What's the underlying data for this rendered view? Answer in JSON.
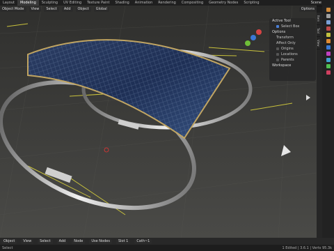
{
  "topbar": {
    "tabs": [
      "Layout",
      "Modeling",
      "Sculpting",
      "UV Editing",
      "Texture Paint",
      "Shading",
      "Animation",
      "Rendering",
      "Compositing",
      "Geometry Nodes",
      "Scripting"
    ],
    "scene": "Scene"
  },
  "viewport_header": {
    "mode": "Object Mode",
    "view": "View",
    "select": "Select",
    "add": "Add",
    "object": "Object",
    "orientation": "Global",
    "options": "Options"
  },
  "npanel": {
    "active_tool": "Active Tool",
    "tool_name": "Select Box",
    "options": "Options",
    "transform": "Transform",
    "affect_only": "Affect Only",
    "origins": "Origins",
    "locations": "Locations",
    "parents": "Parents",
    "workspace": "Workspace"
  },
  "sidetabs": [
    "Item",
    "Tool",
    "View"
  ],
  "bottombar": {
    "editor": "Object",
    "view": "View",
    "select": "Select",
    "add": "Add",
    "node": "Node",
    "use_nodes": "Use Nodes",
    "slot": "Slot 1",
    "material": "Cath~1"
  },
  "statusbar": {
    "left": "Select",
    "right": "1 Edited | 3.6.1 | Verts 95.3k"
  },
  "colors": {
    "ground": "#3a3a38",
    "panel": "#282828",
    "accent": "#4a7fd6",
    "frame": "#c2a560"
  }
}
